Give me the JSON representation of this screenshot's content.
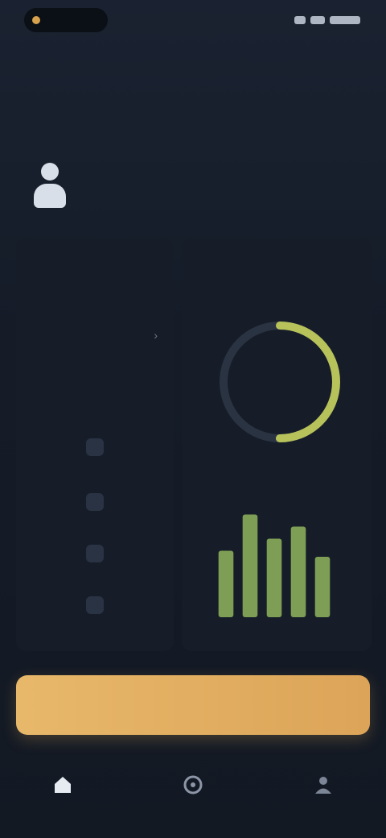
{
  "status_bar": {
    "time": "",
    "accent": "#d6a24e"
  },
  "header": {
    "title": ""
  },
  "page": {
    "heading": ""
  },
  "user": {
    "name": "",
    "subtitle": ""
  },
  "left_panel": {
    "title": "",
    "balance": "",
    "note": "",
    "section_title": "",
    "menu": [
      {
        "icon": "",
        "label": ""
      },
      {
        "icon": "",
        "label": ""
      },
      {
        "icon": "",
        "label": ""
      },
      {
        "icon": "",
        "label": ""
      }
    ]
  },
  "right_panel": {
    "title": "",
    "donut": {
      "center_label": "",
      "fraction": 0.5,
      "color": "#b7c25a",
      "track_color": "#2a3342"
    },
    "bars": {
      "values": [
        0.55,
        0.85,
        0.65,
        0.75,
        0.5
      ],
      "color": "#8fb55c"
    }
  },
  "cta": {
    "label": "",
    "color": "#e4b064"
  },
  "bottom_nav": {
    "items": [
      {
        "icon": "home-icon"
      },
      {
        "icon": "compass-icon"
      },
      {
        "icon": "profile-icon"
      }
    ]
  }
}
